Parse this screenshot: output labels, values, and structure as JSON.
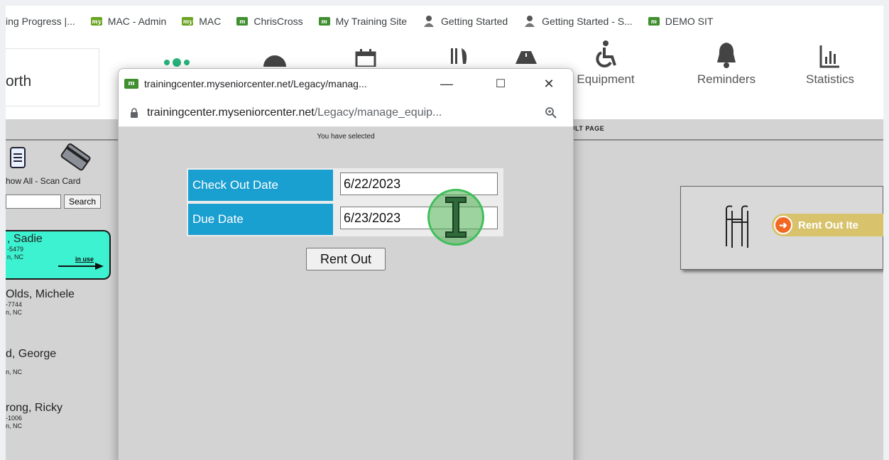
{
  "bookmarks": [
    {
      "label": "ing Progress |...",
      "icon": "generic-favicon"
    },
    {
      "label": "MAC - Admin",
      "icon": "my-favicon"
    },
    {
      "label": "MAC",
      "icon": "my-favicon"
    },
    {
      "label": "ChrisCross",
      "icon": "m2-favicon"
    },
    {
      "label": "My Training Site",
      "icon": "m2-favicon"
    },
    {
      "label": "Getting Started",
      "icon": "person-favicon"
    },
    {
      "label": "Getting Started - S...",
      "icon": "person-favicon"
    },
    {
      "label": "DEMO SIT",
      "icon": "m2-favicon"
    }
  ],
  "header": {
    "brand_partial": "orth",
    "nav": [
      {
        "label": "",
        "icon": "dots-icon"
      },
      {
        "label": "",
        "icon": "check-circle-icon"
      },
      {
        "label": "",
        "icon": "calendar-icon"
      },
      {
        "label": "",
        "icon": "utensils-icon"
      },
      {
        "label": "",
        "icon": "road-icon"
      },
      {
        "label": "Equipment",
        "icon": "wheelchair-icon"
      },
      {
        "label": "Reminders",
        "icon": "bell-icon"
      },
      {
        "label": "Statistics",
        "icon": "bar-chart-icon"
      }
    ]
  },
  "sidebar": {
    "links_text": "how All - Scan Card",
    "search_label": "Search",
    "people": [
      {
        "name": ", Sadie",
        "line1": "-5479",
        "line2": "n, NC",
        "status": "in use"
      },
      {
        "name": "Olds, Michele",
        "line1": "-7744",
        "line2": "n, NC",
        "status": ""
      },
      {
        "name": "d, George",
        "line1": "",
        "line2": "n, NC",
        "status": ""
      },
      {
        "name": "rong, Ricky",
        "line1": "-1006",
        "line2": "n, NC",
        "status": ""
      }
    ]
  },
  "result": {
    "title": "ULT PAGE",
    "rent_item_label": "Rent Out Ite"
  },
  "popup": {
    "title": "trainingcenter.myseniorcenter.net/Legacy/manag...",
    "url_host": "trainingcenter.myseniorcenter.net",
    "url_path": "/Legacy/manage_equip...",
    "selected_text": "You have selected",
    "checkout_label": "Check Out Date",
    "checkout_value": "6/22/2023",
    "due_label": "Due Date",
    "due_value": "6/23/2023",
    "rent_out_label": "Rent Out",
    "minimize": "—",
    "maximize": "☐",
    "close": "✕"
  },
  "colors": {
    "label_blue": "#1a9fd1",
    "active_card": "#3df2d0",
    "accent_green": "#26b37a",
    "cursor_green": "#3fbf5a"
  }
}
